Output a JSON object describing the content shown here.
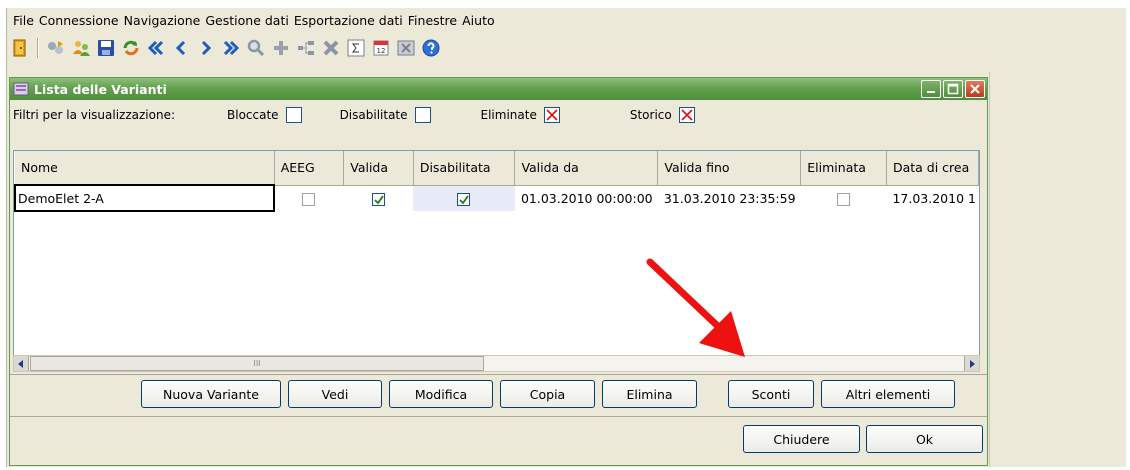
{
  "menu": [
    "File",
    "Connessione",
    "Navigazione",
    "Gestione dati",
    "Esportazione dati",
    "Finestre",
    "Aiuto"
  ],
  "window": {
    "title": "Lista delle Varianti"
  },
  "filters": {
    "label": "Filtri per la visualizzazione:",
    "bloccate": "Bloccate",
    "disabilitate": "Disabilitate",
    "eliminate": "Eliminate",
    "storico": "Storico"
  },
  "table": {
    "headers": [
      "Nome",
      "AEEG",
      "Valida",
      "Disabilitata",
      "Valida da",
      "Valida fino",
      "Eliminata",
      "Data di crea"
    ],
    "row": {
      "nome": "DemoElet 2-A",
      "valida_da": "01.03.2010 00:00:00",
      "valida_fino": "31.03.2010 23:35:59",
      "data_creazione": "17.03.2010 1"
    }
  },
  "buttons": {
    "nuova_variante": "Nuova Variante",
    "vedi": "Vedi",
    "modifica": "Modifica",
    "copia": "Copia",
    "elimina": "Elimina",
    "sconti": "Sconti",
    "altri_elementi": "Altri elementi",
    "chiudere": "Chiudere",
    "ok": "Ok"
  },
  "scrollbar": {
    "grip": "III"
  },
  "colors": {
    "title_green": "#63a14f",
    "annotation_arrow": "#ee1111"
  }
}
